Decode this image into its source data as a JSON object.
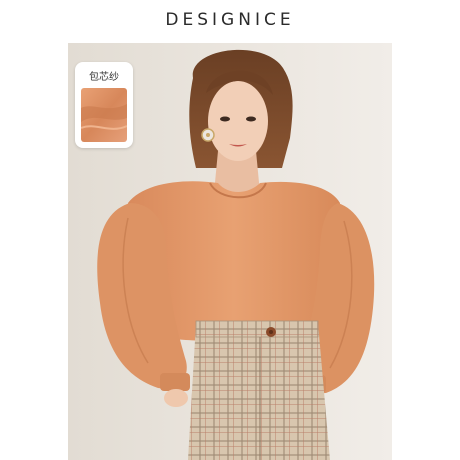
{
  "brand": {
    "name": "DESIGNICE"
  },
  "fabric_badge": {
    "label": "包芯纱"
  },
  "colors": {
    "background": "#ffffff",
    "studio_wall": "#e8e3dc",
    "blouse": "#e39a6b",
    "blouse_shadow": "#c97a4e",
    "hair": "#7a4a2c",
    "skin": "#f0cdb5",
    "plaid": "#c9b39a"
  }
}
